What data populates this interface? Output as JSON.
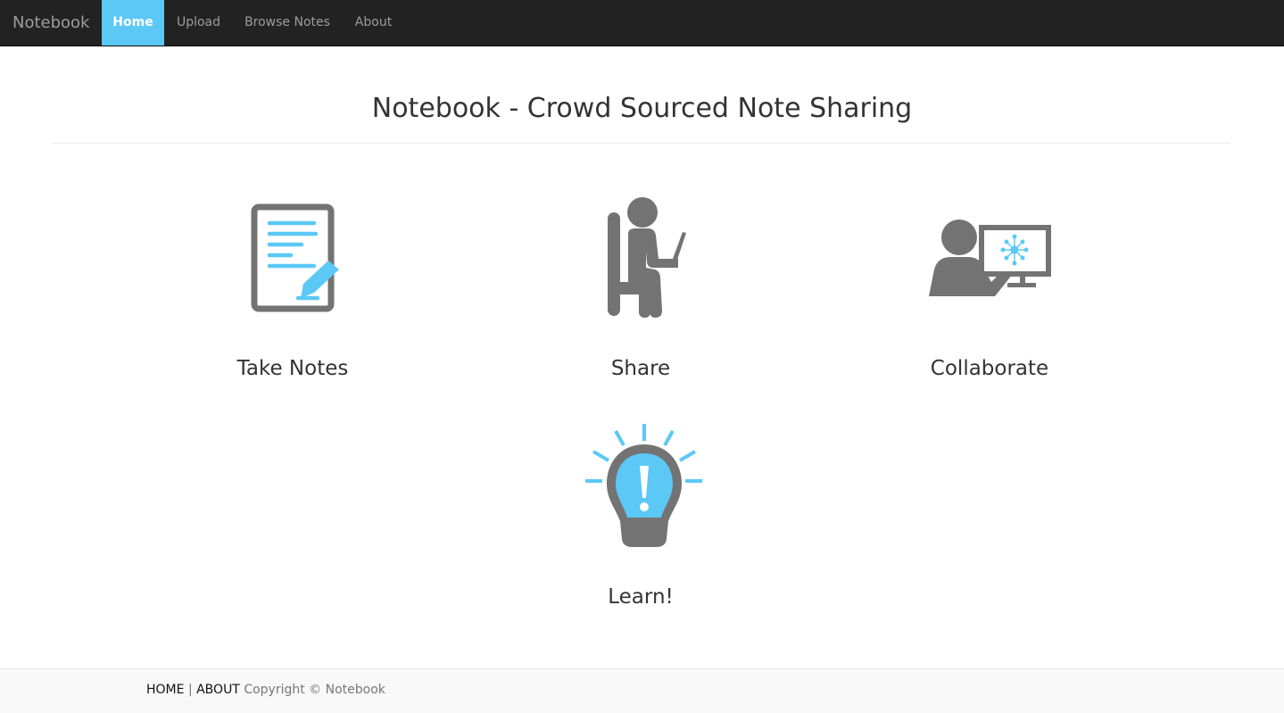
{
  "nav": {
    "brand": "Notebook",
    "items": [
      {
        "label": "Home",
        "active": true
      },
      {
        "label": "Upload",
        "active": false
      },
      {
        "label": "Browse Notes",
        "active": false
      },
      {
        "label": "About",
        "active": false
      }
    ]
  },
  "main": {
    "title": "Notebook - Crowd Sourced Note Sharing",
    "features": [
      {
        "label": "Take Notes",
        "icon": "notepad-pencil-icon"
      },
      {
        "label": "Share",
        "icon": "person-laptop-icon"
      },
      {
        "label": "Collaborate",
        "icon": "person-presentation-icon"
      },
      {
        "label": "Learn!",
        "icon": "lightbulb-icon"
      }
    ]
  },
  "footer": {
    "home_link": "HOME",
    "separator": "|",
    "about_link": "ABOUT",
    "copyright": "Copyright © Notebook"
  },
  "colors": {
    "navbar_bg": "#222222",
    "accent": "#5bc8f5",
    "icon_gray": "#737373"
  }
}
